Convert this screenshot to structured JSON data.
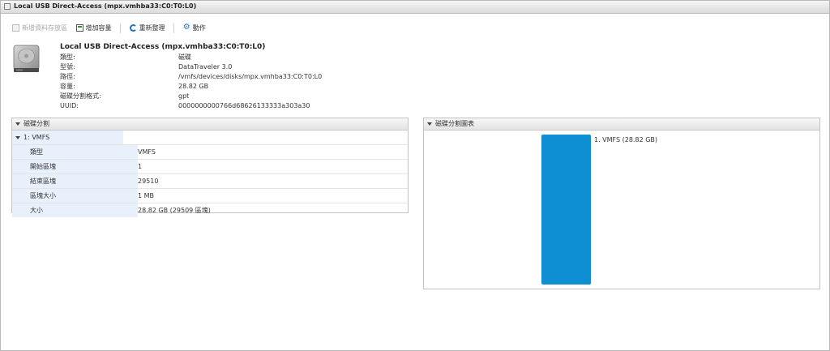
{
  "window": {
    "title": "Local USB Direct-Access (mpx.vmhba33:C0:T0:L0)"
  },
  "toolbar": {
    "new_datastore": "新增資料存放區",
    "add_capacity": "增加容量",
    "rescan": "重新整理",
    "actions": "動作"
  },
  "device": {
    "name": "Local USB Direct-Access (mpx.vmhba33:C0:T0:L0)",
    "fields": [
      {
        "label": "類型:",
        "value": "磁碟"
      },
      {
        "label": "型號:",
        "value": "DataTraveler 3.0"
      },
      {
        "label": "路徑:",
        "value": "/vmfs/devices/disks/mpx.vmhba33:C0:T0:L0"
      },
      {
        "label": "容量:",
        "value": "28.82 GB"
      },
      {
        "label": "磁碟分割格式:",
        "value": "gpt"
      },
      {
        "label": "UUID:",
        "value": "0000000000766d68626133333a303a30"
      }
    ]
  },
  "partitions_panel": {
    "title": "磁碟分割",
    "group": "1: VMFS",
    "rows": [
      {
        "label": "類型",
        "value": "VMFS"
      },
      {
        "label": "開始區塊",
        "value": "1"
      },
      {
        "label": "結束區塊",
        "value": "29510"
      },
      {
        "label": "區塊大小",
        "value": "1 MB"
      },
      {
        "label": "大小",
        "value": "28.82 GB (29509 區塊)"
      }
    ]
  },
  "diagram_panel": {
    "title": "磁碟分割圖表",
    "partition_label": "1. VMFS  (28.82 GB)",
    "bar_color": "#0f8fd3",
    "fill_fraction": 1.0
  }
}
